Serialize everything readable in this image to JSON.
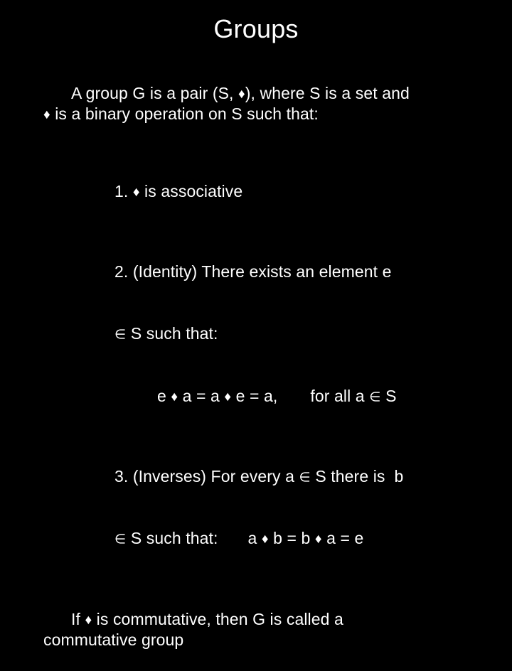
{
  "slide": {
    "title": "Groups",
    "background_color": "#000000",
    "text_color": "#ffffff"
  },
  "symbols": {
    "operation": "♦",
    "element_of": "∈"
  },
  "intro": {
    "line1_a": "A group G is a pair (S, ",
    "line1_b": "), where S is a set and",
    "line2_a": "",
    "line2_b": " is a binary operation on S such that:"
  },
  "items": [
    {
      "number": "1. ",
      "text_after_op": " is associative"
    },
    {
      "number": "2. ",
      "text": "(Identity) There exists an element e",
      "sub_text": " S such that:",
      "equation_left": "e ",
      "equation_mid_a": " a = a ",
      "equation_mid_b": " e = a,",
      "equation_right": "for all a ",
      "equation_right_tail": " S"
    },
    {
      "number": "3. ",
      "text_a": "(Inverses) For every a ",
      "text_b": " S there is  b",
      "sub_text": " S such that:",
      "equation_left": "a ",
      "equation_mid_a": " b = b ",
      "equation_mid_b": " a = e"
    }
  ],
  "closing": {
    "line_a": "If ",
    "line_b": " is commutative, then G is called a",
    "line_c": "commutative group"
  }
}
